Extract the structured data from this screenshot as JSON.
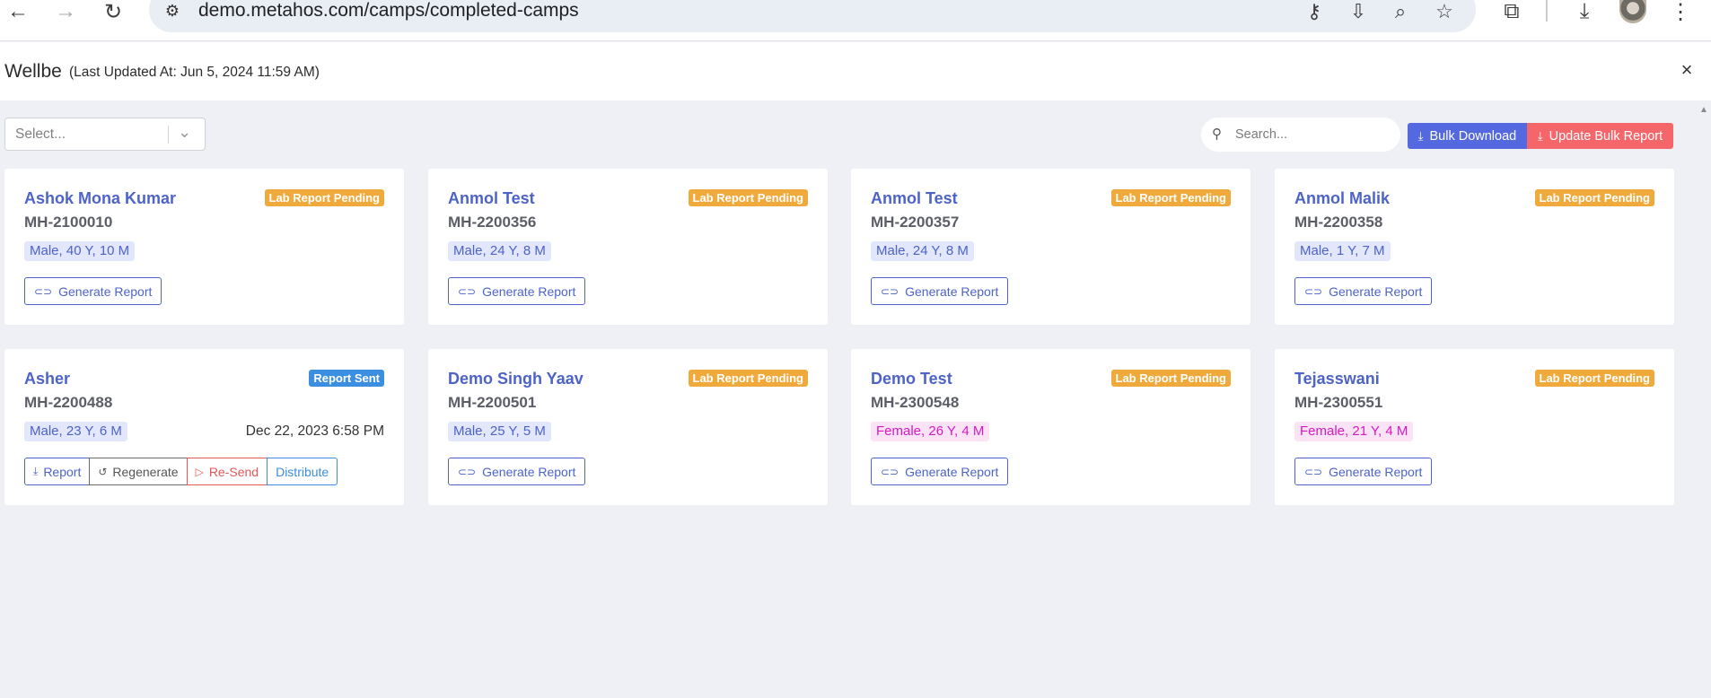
{
  "browser": {
    "url": "demo.metahos.com/camps/completed-camps",
    "back_icon": "←",
    "forward_icon": "→",
    "reload_icon": "↻",
    "tune_icon": "⚙",
    "key_icon": "⚷",
    "install_icon": "⇩",
    "zoom_icon": "⌕",
    "star_icon": "☆",
    "extensions_icon": "⧉",
    "download_icon": "⤓",
    "menu_icon": "⋮"
  },
  "header": {
    "title": "Wellbe",
    "updated": "(Last Updated At: Jun 5, 2024 11:59 AM)",
    "close_icon": "×"
  },
  "toolbar": {
    "select_placeholder": "Select...",
    "select_chevron": "⌄",
    "search_icon": "⚲",
    "search_placeholder": "Search...",
    "bulk_download_label": "Bulk Download",
    "update_bulk_label": "Update Bulk Report",
    "download_glyph": "⤓"
  },
  "cards": [
    {
      "name": "Ashok Mona Kumar",
      "id": "MH-2100010",
      "status": "Lab Report Pending",
      "tag": "Male, 40 Y, 10 M",
      "button": "Generate Report"
    },
    {
      "name": "Anmol Test",
      "id": "MH-2200356",
      "status": "Lab Report Pending",
      "tag": "Male, 24 Y, 8 M",
      "button": "Generate Report"
    },
    {
      "name": "Anmol Test",
      "id": "MH-2200357",
      "status": "Lab Report Pending",
      "tag": "Male, 24 Y, 8 M",
      "button": "Generate Report"
    },
    {
      "name": "Anmol Malik",
      "id": "MH-2200358",
      "status": "Lab Report Pending",
      "tag": "Male, 1 Y, 7 M",
      "button": "Generate Report"
    },
    {
      "name": "Asher",
      "id": "MH-2200488",
      "status": "Report Sent",
      "tag": "Male, 23 Y, 6 M",
      "date": "Dec 22, 2023 6:58 PM",
      "actions": {
        "report": "Report",
        "regenerate": "Regenerate",
        "resend": "Re-Send",
        "distribute": "Distribute"
      }
    },
    {
      "name": "Demo Singh Yaav",
      "id": "MH-2200501",
      "status": "Lab Report Pending",
      "tag": "Male, 25 Y, 5 M",
      "button": "Generate Report"
    },
    {
      "name": "Demo Test",
      "id": "MH-2300548",
      "status": "Lab Report Pending",
      "tag": "Female, 26 Y, 4 M",
      "button": "Generate Report"
    },
    {
      "name": "Tejasswani",
      "id": "MH-2300551",
      "status": "Lab Report Pending",
      "tag": "Female, 21 Y, 4 M",
      "button": "Generate Report"
    }
  ],
  "glyphs": {
    "link": "⊂⊃",
    "report": "⤓",
    "regenerate": "↺",
    "resend": "▷"
  },
  "colors": {
    "primary": "#4d63c8",
    "pending": "#f0aa3c",
    "sent": "#3b8ee0",
    "danger": "#f5666b",
    "female": "#d61ac2"
  }
}
